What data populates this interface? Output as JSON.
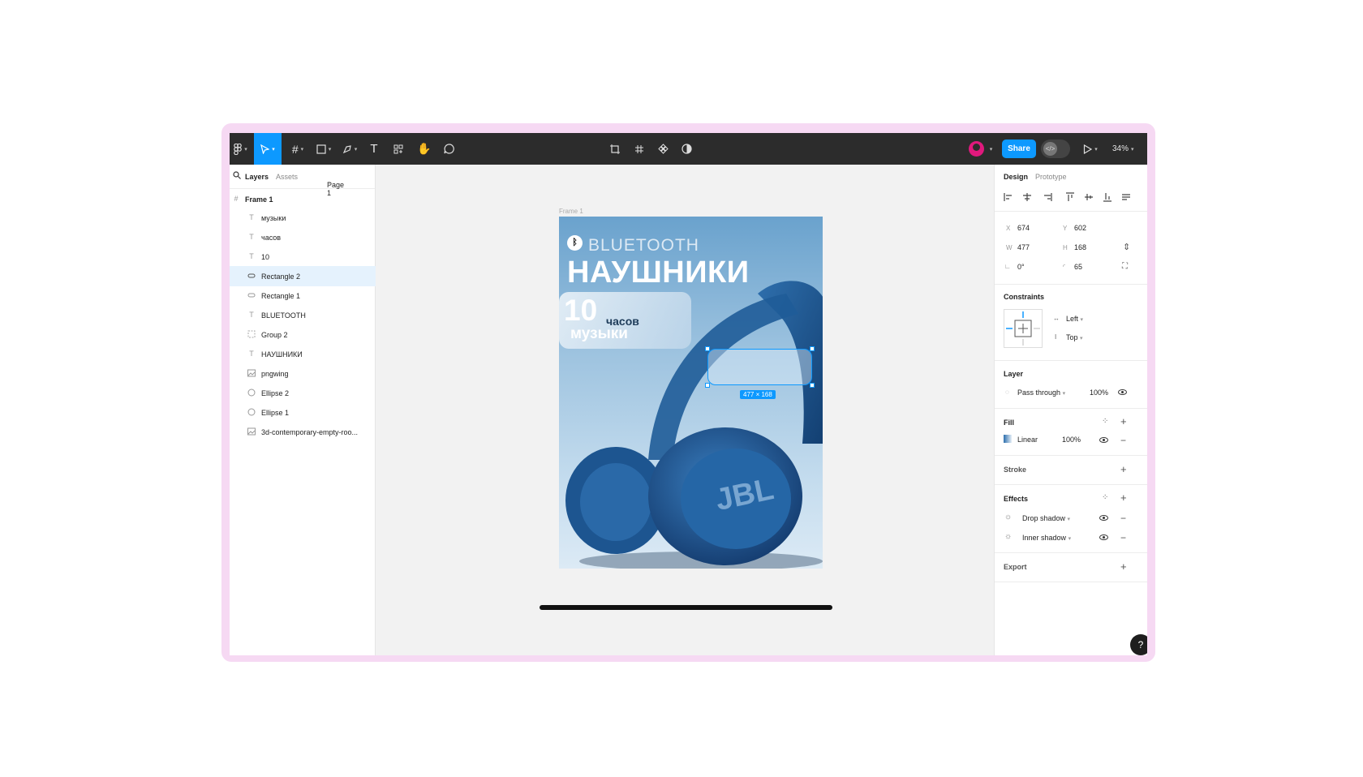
{
  "toolbar": {
    "share_label": "Share",
    "zoom": "34%",
    "dev_mode_symbol": "</>",
    "tools": [
      "figma-menu-icon",
      "move-icon",
      "frame-icon",
      "rectangle-icon",
      "pen-icon",
      "text-icon",
      "resources-icon",
      "hand-icon",
      "comment-icon"
    ],
    "center_tools": [
      "crop-icon",
      "grid-icon",
      "component-icon",
      "contrast-icon"
    ]
  },
  "left_panel": {
    "tabs": {
      "layers": "Layers",
      "assets": "Assets"
    },
    "page": "Page 1",
    "frame_name": "Frame 1",
    "layers": [
      {
        "name": "музыки",
        "icon": "text-icon"
      },
      {
        "name": "часов",
        "icon": "text-icon"
      },
      {
        "name": "10",
        "icon": "text-icon"
      },
      {
        "name": "Rectangle 2",
        "icon": "rectangle-icon",
        "selected": true
      },
      {
        "name": "Rectangle 1",
        "icon": "rectangle-icon"
      },
      {
        "name": "BLUETOOTH",
        "icon": "text-icon"
      },
      {
        "name": "Group 2",
        "icon": "group-icon"
      },
      {
        "name": "НАУШНИКИ",
        "icon": "text-icon"
      },
      {
        "name": "pngwing",
        "icon": "image-icon"
      },
      {
        "name": "Ellipse 2",
        "icon": "ellipse-icon"
      },
      {
        "name": "Ellipse 1",
        "icon": "ellipse-icon"
      },
      {
        "name": "3d-contemporary-empty-roo...",
        "icon": "image-icon"
      }
    ]
  },
  "canvas": {
    "frame_label": "Frame 1",
    "poster": {
      "bluetooth": "BLUETOOTH",
      "title": "НАУШНИКИ",
      "hours_number": "10",
      "hours_word": "часов",
      "music_word": "музыки"
    },
    "selection_size": "477 × 168"
  },
  "right_panel": {
    "tabs": {
      "design": "Design",
      "prototype": "Prototype"
    },
    "x": "674",
    "y": "602",
    "w": "477",
    "h": "168",
    "rotation": "0°",
    "radius": "65",
    "labels": {
      "x": "X",
      "y": "Y",
      "w": "W",
      "h": "H"
    },
    "constraints": {
      "title": "Constraints",
      "horizontal": "Left",
      "vertical": "Top"
    },
    "layer": {
      "title": "Layer",
      "blend": "Pass through",
      "opacity": "100%"
    },
    "fill": {
      "title": "Fill",
      "type": "Linear",
      "opacity": "100%"
    },
    "stroke": {
      "title": "Stroke"
    },
    "effects": {
      "title": "Effects",
      "items": [
        "Drop shadow",
        "Inner shadow"
      ]
    },
    "export": {
      "title": "Export"
    }
  },
  "help_label": "?",
  "colors": {
    "accent": "#0d99ff",
    "toolbar_bg": "#2c2c2c",
    "device_border": "#f6d9f3"
  }
}
